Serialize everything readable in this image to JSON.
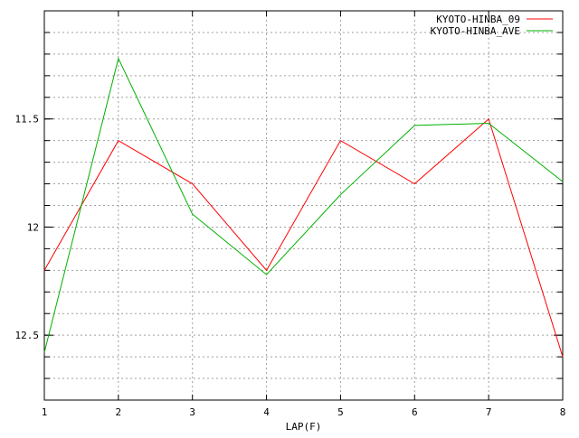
{
  "chart_data": {
    "type": "line",
    "title": "",
    "xlabel": "LAP(F)",
    "ylabel": "",
    "x": [
      1,
      2,
      3,
      4,
      5,
      6,
      7,
      8
    ],
    "xlim": [
      1,
      8
    ],
    "ylim": [
      11.0,
      12.8
    ],
    "y_reversed": true,
    "x_ticks": [
      "1",
      "2",
      "3",
      "4",
      "5",
      "6",
      "7",
      "8"
    ],
    "y_ticks": [
      {
        "value": 11.5,
        "label": "11.5"
      },
      {
        "value": 12.0,
        "label": "12"
      },
      {
        "value": 12.5,
        "label": "12.5"
      }
    ],
    "grid": true,
    "legend_position": "top-right",
    "series": [
      {
        "name": "KYOTO-HINBA_09",
        "color": "#ff0000",
        "values": [
          12.2,
          11.6,
          11.8,
          12.2,
          11.6,
          11.8,
          11.5,
          12.6
        ]
      },
      {
        "name": "KYOTO-HINBA_AVE",
        "color": "#00b000",
        "values": [
          12.58,
          11.22,
          11.94,
          12.22,
          11.85,
          11.53,
          11.52,
          11.79
        ]
      }
    ]
  }
}
